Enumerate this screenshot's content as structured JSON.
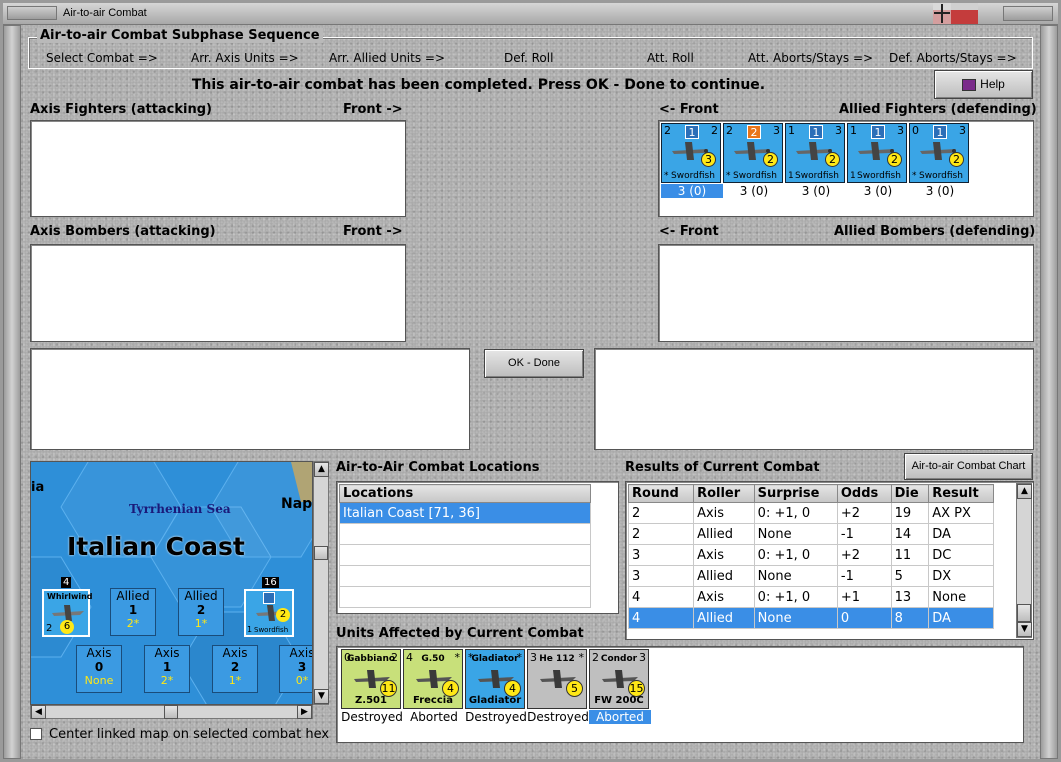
{
  "window": {
    "title": "Air-to-air Combat"
  },
  "subphase": {
    "legend": "Air-to-air Combat Subphase Sequence",
    "steps": [
      "Select Combat =>",
      "Arr. Axis Units =>",
      "Arr. Allied Units =>",
      "Def. Roll",
      "Att. Roll",
      "Att. Aborts/Stays =>",
      "Def. Aborts/Stays =>"
    ]
  },
  "status_message": "This air-to-air combat has been completed.  Press OK - Done to continue.",
  "help_button": "Help",
  "ok_button": "OK - Done",
  "chart_button": "Air-to-air Combat Chart",
  "axis_fighters": {
    "label": "Axis Fighters (attacking)",
    "front": "Front ->"
  },
  "allied_fighters": {
    "label": "Allied Fighters (defending)",
    "front": "<- Front",
    "counters": [
      {
        "attack": "2",
        "defense": "2",
        "box": "1",
        "box_color": "#2b6fb8",
        "range": "3",
        "move": "*",
        "name": "Swordfish",
        "caption": "3 (0)",
        "selected": true
      },
      {
        "attack": "2",
        "defense": "3",
        "box": "2",
        "box_color": "#e8751a",
        "range": "2",
        "move": "*",
        "name": "Swordfish",
        "caption": "3 (0)",
        "selected": false
      },
      {
        "attack": "1",
        "defense": "3",
        "box": "1",
        "box_color": "#2b6fb8",
        "range": "2",
        "move": "1",
        "name": "Swordfish",
        "caption": "3 (0)",
        "selected": false
      },
      {
        "attack": "1",
        "defense": "3",
        "box": "1",
        "box_color": "#2b6fb8",
        "range": "2",
        "move": "1",
        "name": "Swordfish",
        "caption": "3 (0)",
        "selected": false
      },
      {
        "attack": "0",
        "defense": "3",
        "box": "1",
        "box_color": "#2b6fb8",
        "range": "2",
        "move": "*",
        "name": "Swordfish",
        "caption": "3 (0)",
        "selected": false
      }
    ]
  },
  "axis_bombers": {
    "label": "Axis Bombers (attacking)",
    "front": "Front ->"
  },
  "allied_bombers": {
    "label": "Allied Bombers (defending)",
    "front": "<- Front"
  },
  "map": {
    "sea_label": "Tyrrhenian Sea",
    "region_label": "Italian Coast",
    "edge_left": "ia",
    "edge_right": "Napl",
    "left_stack": {
      "count": "4",
      "name": "Whirlwind",
      "range": "6",
      "move": "2"
    },
    "right_stack": {
      "count": "16",
      "name": "Swordfish",
      "range": "2",
      "move": "1"
    },
    "allied_boxes": [
      {
        "title": "Allied",
        "num": "1",
        "sub": "2*"
      },
      {
        "title": "Allied",
        "num": "2",
        "sub": "1*"
      }
    ],
    "axis_boxes": [
      {
        "title": "Axis",
        "num": "0",
        "sub": "None"
      },
      {
        "title": "Axis",
        "num": "1",
        "sub": "2*"
      },
      {
        "title": "Axis",
        "num": "2",
        "sub": "1*"
      },
      {
        "title": "Axis",
        "num": "3",
        "sub": "0*"
      }
    ],
    "center_checkbox": "Center linked map on selected combat hex"
  },
  "locations": {
    "label": "Air-to-Air Combat Locations",
    "header": "Locations",
    "rows": [
      "Italian Coast [71, 36]"
    ]
  },
  "results": {
    "label": "Results of Current Combat",
    "headers": [
      "Round",
      "Roller",
      "Surprise",
      "Odds",
      "Die",
      "Result"
    ],
    "rows": [
      [
        "2",
        "Axis",
        "0: +1, 0",
        "+2",
        "19",
        "AX PX"
      ],
      [
        "2",
        "Allied",
        "None",
        "-1",
        "14",
        "DA"
      ],
      [
        "3",
        "Axis",
        "0: +1, 0",
        "+2",
        "11",
        "DC"
      ],
      [
        "3",
        "Allied",
        "None",
        "-1",
        "5",
        "DX"
      ],
      [
        "4",
        "Axis",
        "0: +1, 0",
        "+1",
        "13",
        "None"
      ],
      [
        "4",
        "Allied",
        "None",
        "0",
        "8",
        "DA"
      ]
    ],
    "selected_row": 5
  },
  "units_affected": {
    "label": "Units Affected by Current Combat",
    "units": [
      {
        "name": "Gabbiano",
        "attack": "0",
        "defense": "2",
        "range": "11",
        "bottom": "Z.501",
        "color": "#c8e07a",
        "range_color": "#ffe816",
        "caption": "Destroyed",
        "selected": false
      },
      {
        "name": "G.50",
        "attack": "4",
        "defense": "*",
        "range": "4",
        "bottom": "Freccia",
        "color": "#c8e07a",
        "range_color": "#ffe816",
        "caption": "Aborted",
        "selected": false
      },
      {
        "name": "Gladiator",
        "attack": "*",
        "defense": "*",
        "range": "4",
        "bottom": "Gladiator",
        "color": "#3aa5e6",
        "range_color": "#ffe816",
        "caption": "Destroyed",
        "selected": false
      },
      {
        "name": "He 112",
        "attack": "3",
        "defense": "*",
        "range": "5",
        "bottom": "",
        "color": "#bfbfbf",
        "range_color": "#ffe816",
        "caption": "Destroyed",
        "selected": false
      },
      {
        "name": "Condor",
        "attack": "2",
        "defense": "3",
        "range": "15",
        "bottom": "FW 200C",
        "color": "#bfbfbf",
        "range_color": "#ffe816",
        "caption": "Aborted",
        "selected": true
      }
    ]
  },
  "colors": {
    "selection": "#3a8ee6",
    "counter_allied": "#3aa5e6",
    "counter_italian": "#c8e07a",
    "counter_german": "#bfbfbf",
    "map_sea": "#2e8fd8"
  }
}
